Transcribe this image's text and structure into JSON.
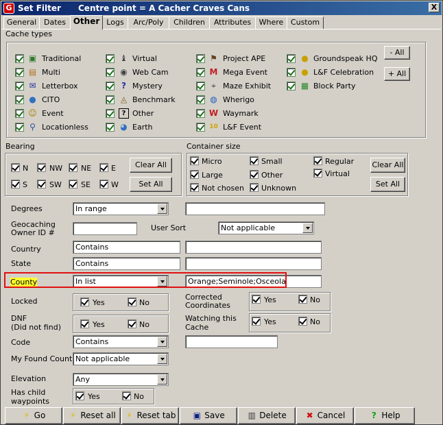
{
  "window": {
    "title": "Set Filter",
    "subtitle": "Centre point = A Cacher Craves Cans",
    "close": "X"
  },
  "tabs": [
    "General",
    "Dates",
    "Other",
    "Logs",
    "Arc/Poly",
    "Children",
    "Attributes",
    "Where",
    "Custom"
  ],
  "cache_types": {
    "title": "Cache types",
    "col1": [
      "Traditional",
      "Multi",
      "Letterbox",
      "CITO",
      "Event",
      "Locationless"
    ],
    "col2": [
      "Virtual",
      "Web Cam",
      "Mystery",
      "Benchmark",
      "Other",
      "Earth"
    ],
    "col3": [
      "Project APE",
      "Mega Event",
      "Maze Exhibit",
      "Wherigo",
      "Waymark",
      "L&F Event"
    ],
    "col4": [
      "Groundspeak HQ",
      "L&F Celebration",
      "Block Party"
    ],
    "minus_all": "- All",
    "plus_all": "+ All"
  },
  "bearing": {
    "title": "Bearing",
    "row1": [
      "N",
      "NW",
      "NE",
      "E"
    ],
    "row2": [
      "S",
      "SW",
      "SE",
      "W"
    ],
    "clear_all": "Clear All",
    "set_all": "Set All"
  },
  "container": {
    "title": "Container size",
    "col1": [
      "Micro",
      "Large",
      "Not chosen"
    ],
    "col2": [
      "Small",
      "Other",
      "Unknown"
    ],
    "col3": [
      "Regular",
      "Virtual"
    ],
    "clear_all": "Clear All",
    "set_all": "Set All"
  },
  "fields": {
    "degrees": {
      "label": "Degrees",
      "value": "In range",
      "text": ""
    },
    "owner": {
      "label1": "Geocaching",
      "label2": "Owner ID #",
      "value": ""
    },
    "user_sort": {
      "label": "User Sort",
      "value": "Not applicable"
    },
    "country": {
      "label": "Country",
      "value": "Contains",
      "text": ""
    },
    "state": {
      "label": "State",
      "value": "Contains",
      "text": ""
    },
    "county": {
      "label": "County",
      "value": "In list",
      "text": "Orange;Seminole;Osceola"
    },
    "locked": {
      "label": "Locked",
      "yes": "Yes",
      "no": "No"
    },
    "corrected": {
      "label1": "Corrected",
      "label2": "Coordinates",
      "yes": "Yes",
      "no": "No"
    },
    "dnf": {
      "label1": "DNF",
      "label2": "(Did not find)",
      "yes": "Yes",
      "no": "No"
    },
    "watching": {
      "label1": "Watching this",
      "label2": "Cache",
      "yes": "Yes",
      "no": "No"
    },
    "code": {
      "label": "Code",
      "value": "Contains",
      "text": ""
    },
    "found_count": {
      "label": "My Found Count",
      "value": "Not applicable"
    },
    "elevation": {
      "label": "Elevation",
      "value": "Any"
    },
    "child": {
      "label1": "Has child",
      "label2": "waypoints",
      "yes": "Yes",
      "no": "No"
    }
  },
  "buttons": [
    {
      "label": "Go",
      "icon": "lightning-icon"
    },
    {
      "label": "Reset all",
      "icon": "lightning-icon"
    },
    {
      "label": "Reset tab",
      "icon": "lightning-icon"
    },
    {
      "label": "Save",
      "icon": "floppy-icon"
    },
    {
      "label": "Delete",
      "icon": "trash-icon"
    },
    {
      "label": "Cancel",
      "icon": "x-icon"
    },
    {
      "label": "Help",
      "icon": "question-icon"
    }
  ],
  "colors": {
    "title_start": "#0a246a",
    "title_end": "#3a6ea5",
    "highlight_border": "#e01010",
    "highlight_label": "#ffff30"
  }
}
